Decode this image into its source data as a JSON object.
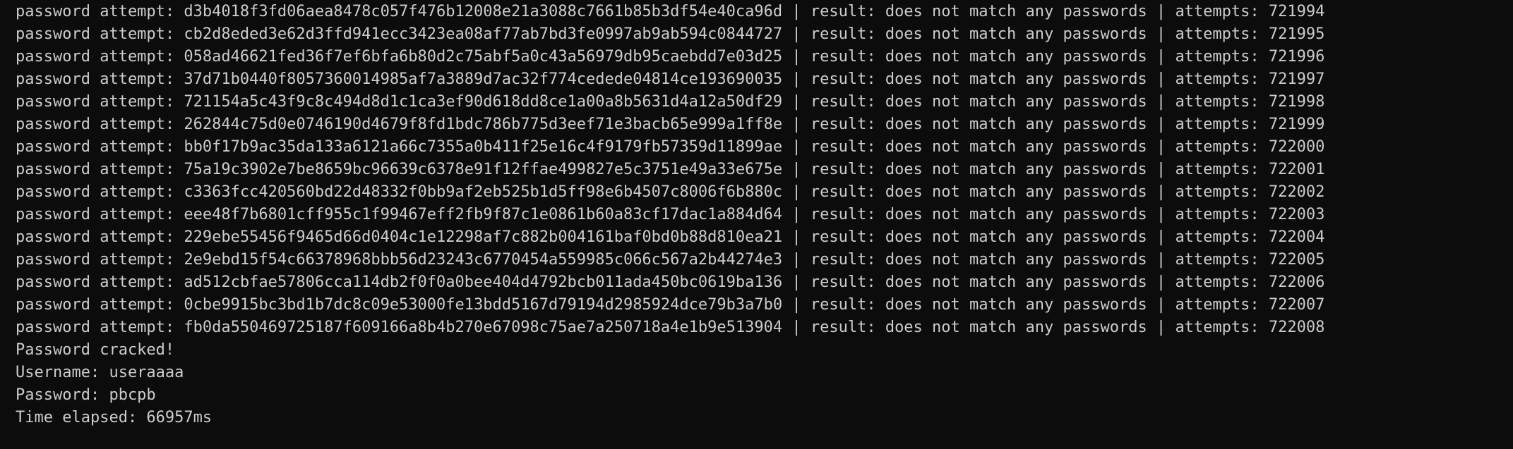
{
  "terminal": {
    "attempt_lines": [
      {
        "prefix": "password attempt: ",
        "hash": "d3b4018f3fd06aea8478c057f476b12008e21a3088c7661b85b3df54e40ca96d",
        "sep1": " | ",
        "result": "result: does not match any passwords",
        "sep2": " | ",
        "attempts": "attempts: 721994"
      },
      {
        "prefix": "password attempt: ",
        "hash": "cb2d8eded3e62d3ffd941ecc3423ea08af77ab7bd3fe0997ab9ab594c0844727",
        "sep1": " | ",
        "result": "result: does not match any passwords",
        "sep2": " | ",
        "attempts": "attempts: 721995"
      },
      {
        "prefix": "password attempt: ",
        "hash": "058ad46621fed36f7ef6bfa6b80d2c75abf5a0c43a56979db95caebdd7e03d25",
        "sep1": " | ",
        "result": "result: does not match any passwords",
        "sep2": " | ",
        "attempts": "attempts: 721996"
      },
      {
        "prefix": "password attempt: ",
        "hash": "37d71b0440f8057360014985af7a3889d7ac32f774cedede04814ce193690035",
        "sep1": " | ",
        "result": "result: does not match any passwords",
        "sep2": " | ",
        "attempts": "attempts: 721997"
      },
      {
        "prefix": "password attempt: ",
        "hash": "721154a5c43f9c8c494d8d1c1ca3ef90d618dd8ce1a00a8b5631d4a12a50df29",
        "sep1": " | ",
        "result": "result: does not match any passwords",
        "sep2": " | ",
        "attempts": "attempts: 721998"
      },
      {
        "prefix": "password attempt: ",
        "hash": "262844c75d0e0746190d4679f8fd1bdc786b775d3eef71e3bacb65e999a1ff8e",
        "sep1": " | ",
        "result": "result: does not match any passwords",
        "sep2": " | ",
        "attempts": "attempts: 721999"
      },
      {
        "prefix": "password attempt: ",
        "hash": "bb0f17b9ac35da133a6121a66c7355a0b411f25e16c4f9179fb57359d11899ae",
        "sep1": " | ",
        "result": "result: does not match any passwords",
        "sep2": " | ",
        "attempts": "attempts: 722000"
      },
      {
        "prefix": "password attempt: ",
        "hash": "75a19c3902e7be8659bc96639c6378e91f12ffae499827e5c3751e49a33e675e",
        "sep1": " | ",
        "result": "result: does not match any passwords",
        "sep2": " | ",
        "attempts": "attempts: 722001"
      },
      {
        "prefix": "password attempt: ",
        "hash": "c3363fcc420560bd22d48332f0bb9af2eb525b1d5ff98e6b4507c8006f6b880c",
        "sep1": " | ",
        "result": "result: does not match any passwords",
        "sep2": " | ",
        "attempts": "attempts: 722002"
      },
      {
        "prefix": "password attempt: ",
        "hash": "eee48f7b6801cff955c1f99467eff2fb9f87c1e0861b60a83cf17dac1a884d64",
        "sep1": " | ",
        "result": "result: does not match any passwords",
        "sep2": " | ",
        "attempts": "attempts: 722003"
      },
      {
        "prefix": "password attempt: ",
        "hash": "229ebe55456f9465d66d0404c1e12298af7c882b004161baf0bd0b88d810ea21",
        "sep1": " | ",
        "result": "result: does not match any passwords",
        "sep2": " | ",
        "attempts": "attempts: 722004"
      },
      {
        "prefix": "password attempt: ",
        "hash": "2e9ebd15f54c66378968bbb56d23243c6770454a559985c066c567a2b44274e3",
        "sep1": " | ",
        "result": "result: does not match any passwords",
        "sep2": " | ",
        "attempts": "attempts: 722005"
      },
      {
        "prefix": "password attempt: ",
        "hash": "ad512cbfae57806cca114db2f0f0a0bee404d4792bcb011ada450bc0619ba136",
        "sep1": " | ",
        "result": "result: does not match any passwords",
        "sep2": " | ",
        "attempts": "attempts: 722006"
      },
      {
        "prefix": "password attempt: ",
        "hash": "0cbe9915bc3bd1b7dc8c09e53000fe13bdd5167d79194d2985924dce79b3a7b0",
        "sep1": " | ",
        "result": "result: does not match any passwords",
        "sep2": " | ",
        "attempts": "attempts: 722007"
      },
      {
        "prefix": "password attempt: ",
        "hash": "fb0da550469725187f609166a8b4b270e67098c75ae7a250718a4e1b9e513904",
        "sep1": " | ",
        "result": "result: does not match any passwords",
        "sep2": " | ",
        "attempts": "attempts: 722008"
      }
    ],
    "cracked_message": "Password cracked!",
    "username_line": "Username: useraaaa",
    "password_line": "Password: pbcpb",
    "elapsed_line": "Time elapsed: 66957ms"
  },
  "colors": {
    "background": "#0c0c0c",
    "text": "#cccccc"
  }
}
